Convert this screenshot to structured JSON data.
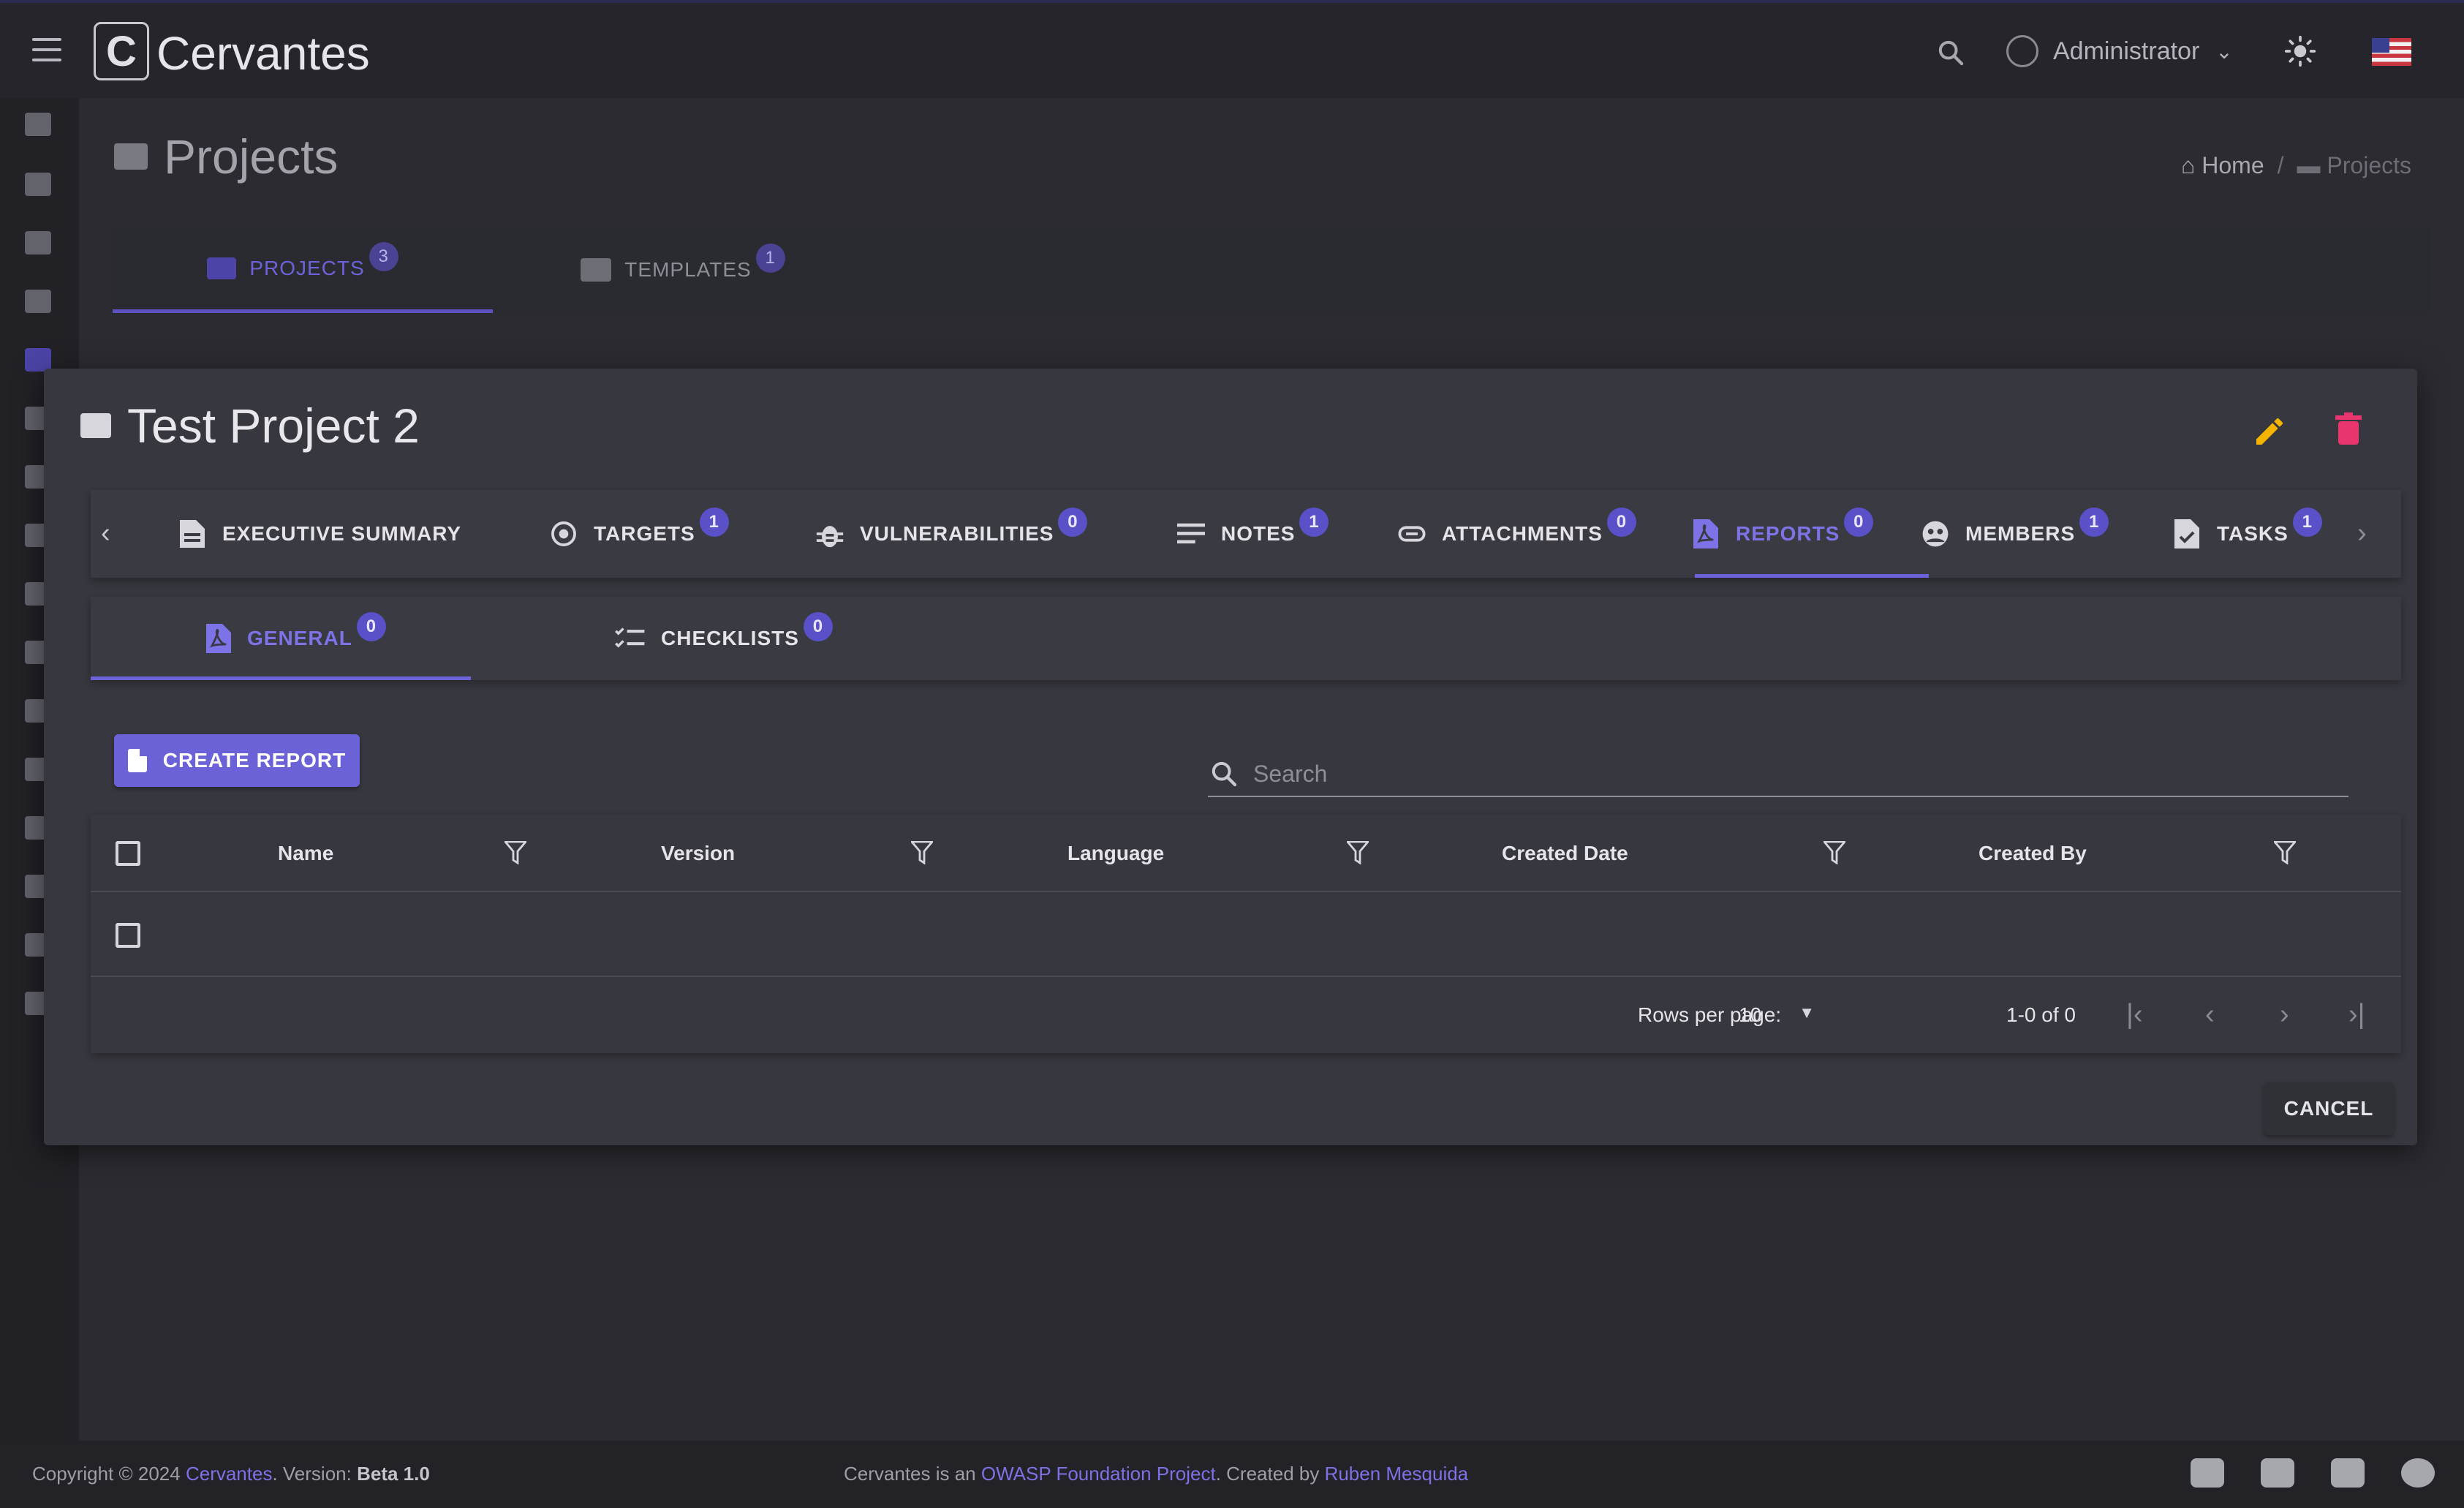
{
  "app": {
    "brand": "Cervantes",
    "user": "Administrator"
  },
  "page": {
    "title": "Projects"
  },
  "breadcrumb": {
    "home": "Home",
    "separator": "/",
    "current": "Projects"
  },
  "outer_tabs": [
    {
      "label": "PROJECTS",
      "badge": "3"
    },
    {
      "label": "TEMPLATES",
      "badge": "1"
    }
  ],
  "modal": {
    "title": "Test Project 2",
    "tabs": [
      {
        "label": "EXECUTIVE SUMMARY",
        "badge": ""
      },
      {
        "label": "TARGETS",
        "badge": "1"
      },
      {
        "label": "VULNERABILITIES",
        "badge": "0"
      },
      {
        "label": "NOTES",
        "badge": "1"
      },
      {
        "label": "ATTACHMENTS",
        "badge": "0"
      },
      {
        "label": "REPORTS",
        "badge": "0"
      },
      {
        "label": "MEMBERS",
        "badge": "1"
      },
      {
        "label": "TASKS",
        "badge": "1"
      }
    ],
    "subtabs": [
      {
        "label": "GENERAL",
        "badge": "0"
      },
      {
        "label": "CHECKLISTS",
        "badge": "0"
      }
    ],
    "create_label": "CREATE REPORT",
    "search_placeholder": "Search",
    "columns": [
      "Name",
      "Version",
      "Language",
      "Created Date",
      "Created By"
    ],
    "rows_per_page_label": "Rows per page:",
    "rows_per_page_value": "10",
    "range": "1-0 of 0",
    "cancel_label": "CANCEL"
  },
  "footer": {
    "copyright": "Copyright © 2024 ",
    "brand_link": "Cervantes",
    "version_label": ". Version: ",
    "version": "Beta 1.0",
    "text1": "Cervantes is an ",
    "owasp_link": "OWASP Foundation Project",
    "text2": ". Created by ",
    "author_link": "Ruben Mesquida"
  },
  "colors": {
    "accent": "#6c62d8",
    "edit": "#f5b400",
    "delete": "#e8356d",
    "background": "#2b2b31"
  }
}
